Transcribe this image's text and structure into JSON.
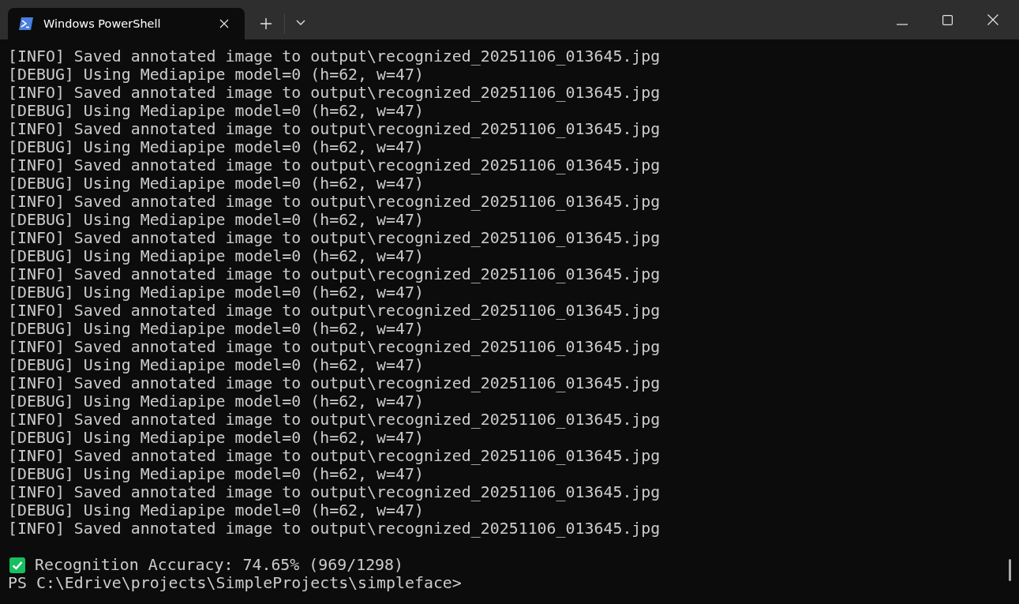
{
  "tabs": [
    {
      "title": "Windows PowerShell",
      "selected": true
    }
  ],
  "output": [
    "[INFO] Saved annotated image to output\\recognized_20251106_013645.jpg",
    "[DEBUG] Using Mediapipe model=0 (h=62, w=47)",
    "[INFO] Saved annotated image to output\\recognized_20251106_013645.jpg",
    "[DEBUG] Using Mediapipe model=0 (h=62, w=47)",
    "[INFO] Saved annotated image to output\\recognized_20251106_013645.jpg",
    "[DEBUG] Using Mediapipe model=0 (h=62, w=47)",
    "[INFO] Saved annotated image to output\\recognized_20251106_013645.jpg",
    "[DEBUG] Using Mediapipe model=0 (h=62, w=47)",
    "[INFO] Saved annotated image to output\\recognized_20251106_013645.jpg",
    "[DEBUG] Using Mediapipe model=0 (h=62, w=47)",
    "[INFO] Saved annotated image to output\\recognized_20251106_013645.jpg",
    "[DEBUG] Using Mediapipe model=0 (h=62, w=47)",
    "[INFO] Saved annotated image to output\\recognized_20251106_013645.jpg",
    "[DEBUG] Using Mediapipe model=0 (h=62, w=47)",
    "[INFO] Saved annotated image to output\\recognized_20251106_013645.jpg",
    "[DEBUG] Using Mediapipe model=0 (h=62, w=47)",
    "[INFO] Saved annotated image to output\\recognized_20251106_013645.jpg",
    "[DEBUG] Using Mediapipe model=0 (h=62, w=47)",
    "[INFO] Saved annotated image to output\\recognized_20251106_013645.jpg",
    "[DEBUG] Using Mediapipe model=0 (h=62, w=47)",
    "[INFO] Saved annotated image to output\\recognized_20251106_013645.jpg",
    "[DEBUG] Using Mediapipe model=0 (h=62, w=47)",
    "[INFO] Saved annotated image to output\\recognized_20251106_013645.jpg",
    "[DEBUG] Using Mediapipe model=0 (h=62, w=47)",
    "[INFO] Saved annotated image to output\\recognized_20251106_013645.jpg",
    "[DEBUG] Using Mediapipe model=0 (h=62, w=47)",
    "[INFO] Saved annotated image to output\\recognized_20251106_013645.jpg"
  ],
  "result": "Recognition Accuracy: 74.65% (969/1298)",
  "prompt": "PS C:\\Edrive\\projects\\SimpleProjects\\simpleface>"
}
